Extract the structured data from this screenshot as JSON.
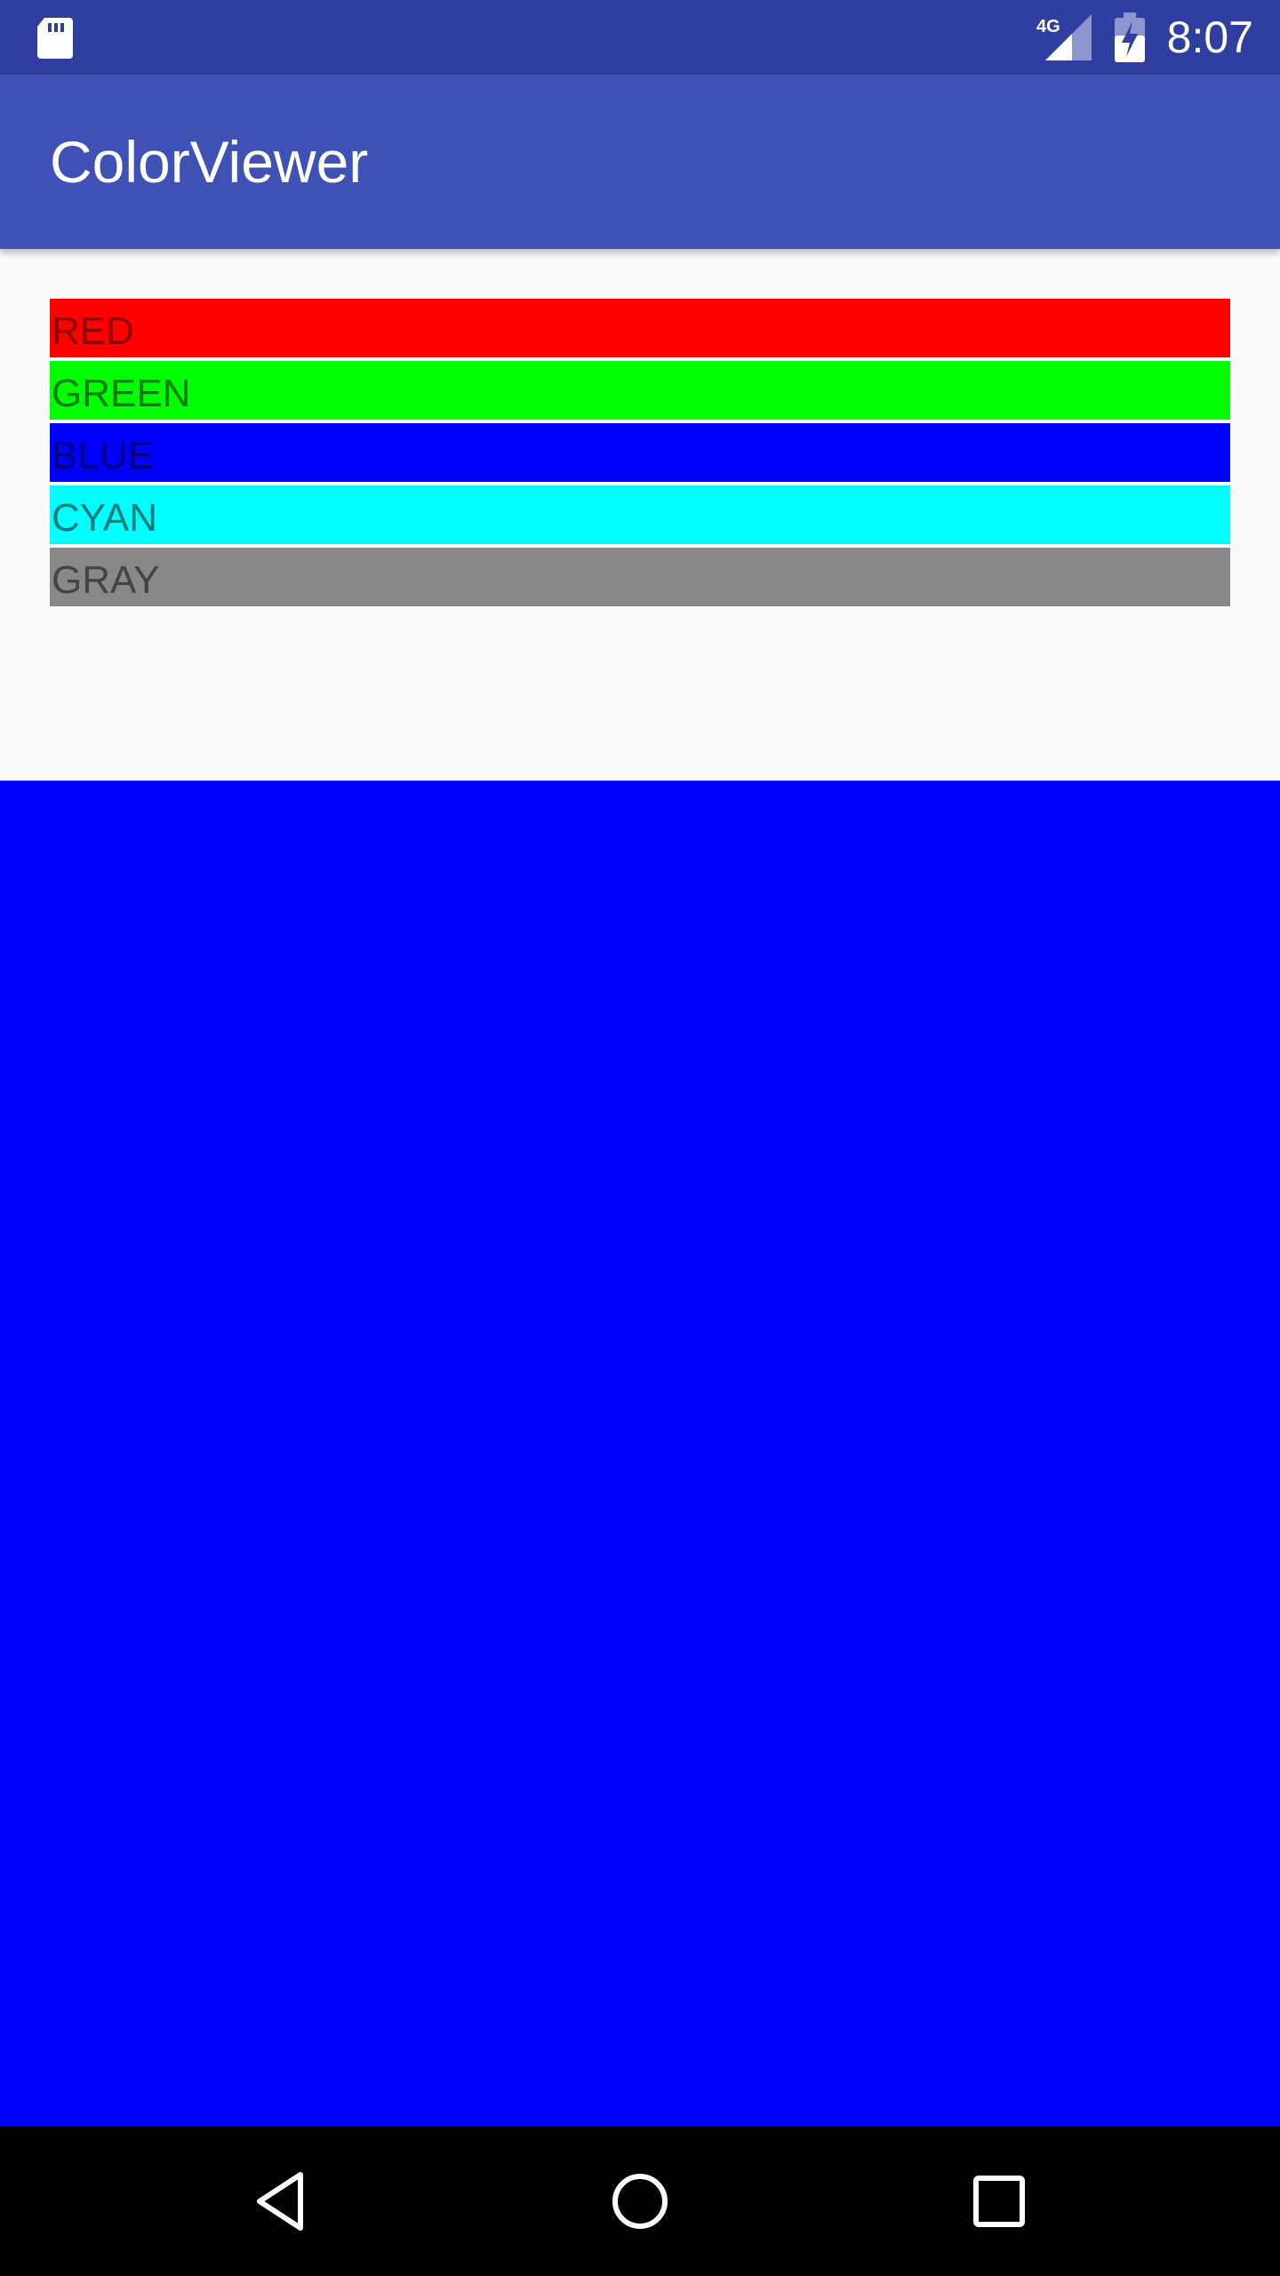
{
  "status_bar": {
    "network_label": "4G",
    "time": "8:07",
    "icons": [
      "sd-card-icon",
      "signal-icon",
      "battery-charging-icon"
    ]
  },
  "app_bar": {
    "title": "ColorViewer"
  },
  "colors": {
    "items": [
      {
        "label": "RED",
        "background": "#FF0000",
        "text_color": "#8B0000"
      },
      {
        "label": "GREEN",
        "background": "#00FF00",
        "text_color": "#007A00"
      },
      {
        "label": "BLUE",
        "background": "#0000FF",
        "text_color": "#00007A"
      },
      {
        "label": "CYAN",
        "background": "#00FFFF",
        "text_color": "#007A7A"
      },
      {
        "label": "GRAY",
        "background": "#888888",
        "text_color": "#444444"
      }
    ],
    "selected_preview_color": "#0000FF"
  },
  "theme": {
    "primary": "#3F51B5",
    "primary_dark": "#303F9F",
    "background": "#FAFAFA"
  },
  "nav_bar": {
    "icons": [
      "back-icon",
      "home-icon",
      "recents-icon"
    ]
  }
}
